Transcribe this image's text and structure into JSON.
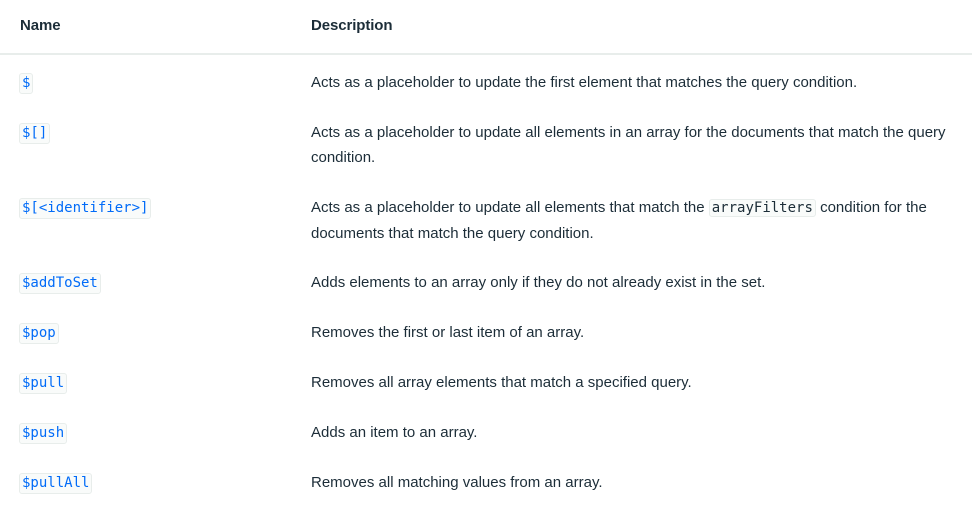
{
  "header": {
    "name": "Name",
    "description": "Description"
  },
  "rows": [
    {
      "name": "$",
      "description": "Acts as a placeholder to update the first element that matches the query condition."
    },
    {
      "name": "$[]",
      "description": "Acts as a placeholder to update all elements in an array for the documents that match the query condition."
    },
    {
      "name": "$[<identifier>]",
      "description_before": "Acts as a placeholder to update all elements that match the",
      "description_code": "arrayFilters",
      "description_after": "condition for the documents that match the query condition."
    },
    {
      "name": "$addToSet",
      "description": "Adds elements to an array only if they do not already exist in the set."
    },
    {
      "name": "$pop",
      "description": "Removes the first or last item of an array."
    },
    {
      "name": "$pull",
      "description": "Removes all array elements that match a specified query."
    },
    {
      "name": "$push",
      "description": "Adds an item to an array."
    },
    {
      "name": "$pullAll",
      "description": "Removes all matching values from an array."
    }
  ],
  "colors": {
    "link_code": "#016bf8",
    "text": "#1c2d38",
    "divider": "#e8edeb"
  }
}
